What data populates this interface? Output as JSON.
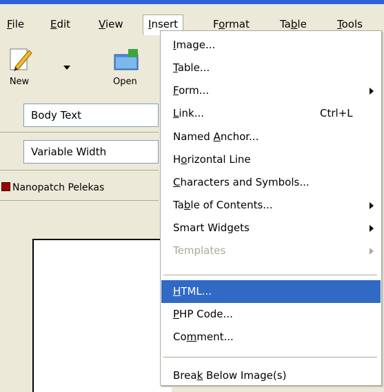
{
  "menubar": [
    {
      "label": "File",
      "u": "F",
      "rest": "ile"
    },
    {
      "label": "Edit",
      "u": "E",
      "rest": "dit"
    },
    {
      "label": "View",
      "u": "V",
      "rest": "iew"
    },
    {
      "label": "Insert",
      "u": "I",
      "rest": "nsert"
    },
    {
      "label": "Format",
      "pre": "F",
      "u": "o",
      "rest": "rmat"
    },
    {
      "label": "Table",
      "pre": "Ta",
      "u": "b",
      "rest": "le"
    },
    {
      "label": "Tools",
      "u": "T",
      "rest": "ools"
    }
  ],
  "toolbar": {
    "new_label": "New",
    "open_label": "Open"
  },
  "format_bar": {
    "paragraph_style": "Body Text",
    "font": "Variable Width"
  },
  "document_tab": {
    "title": "Nanopatch Pelekas"
  },
  "insert_menu": [
    {
      "pre": "",
      "u": "I",
      "post": "mage...",
      "shortcut": "",
      "submenu": false,
      "disabled": false,
      "highlighted": false
    },
    {
      "pre": "",
      "u": "T",
      "post": "able...",
      "shortcut": "",
      "submenu": false,
      "disabled": false,
      "highlighted": false
    },
    {
      "pre": "",
      "u": "F",
      "post": "orm...",
      "shortcut": "",
      "submenu": true,
      "disabled": false,
      "highlighted": false
    },
    {
      "pre": "",
      "u": "L",
      "post": "ink...",
      "shortcut": "Ctrl+L",
      "submenu": false,
      "disabled": false,
      "highlighted": false
    },
    {
      "pre": "Named ",
      "u": "A",
      "post": "nchor...",
      "shortcut": "",
      "submenu": false,
      "disabled": false,
      "highlighted": false
    },
    {
      "pre": "H",
      "u": "o",
      "post": "rizontal Line",
      "shortcut": "",
      "submenu": false,
      "disabled": false,
      "highlighted": false
    },
    {
      "pre": "",
      "u": "C",
      "post": "haracters and Symbols...",
      "shortcut": "",
      "submenu": false,
      "disabled": false,
      "highlighted": false
    },
    {
      "pre": "Ta",
      "u": "b",
      "post": "le of Contents...",
      "shortcut": "",
      "submenu": true,
      "disabled": false,
      "highlighted": false
    },
    {
      "pre": "Smart Widgets",
      "u": "",
      "post": "",
      "shortcut": "",
      "submenu": true,
      "disabled": false,
      "highlighted": false
    },
    {
      "pre": "Templates",
      "u": "",
      "post": "",
      "shortcut": "",
      "submenu": true,
      "disabled": true,
      "highlighted": false
    },
    {
      "separator": true
    },
    {
      "pre": "",
      "u": "H",
      "post": "TML...",
      "shortcut": "",
      "submenu": false,
      "disabled": false,
      "highlighted": true
    },
    {
      "pre": "",
      "u": "P",
      "post": "HP Code...",
      "shortcut": "",
      "submenu": false,
      "disabled": false,
      "highlighted": false
    },
    {
      "pre": "Co",
      "u": "m",
      "post": "ment...",
      "shortcut": "",
      "submenu": false,
      "disabled": false,
      "highlighted": false
    },
    {
      "separator": true
    },
    {
      "pre": "Brea",
      "u": "k",
      "post": " Below Image(s)",
      "shortcut": "",
      "submenu": false,
      "disabled": false,
      "highlighted": false
    }
  ],
  "colors": {
    "highlight": "#316ac5",
    "menubar_bg": "#ece9d8",
    "title_strip": "#2e63d7"
  },
  "icons": [
    "new-document-icon",
    "dropdown-arrow-icon",
    "open-folder-icon",
    "document-icon",
    "submenu-arrow-icon"
  ]
}
